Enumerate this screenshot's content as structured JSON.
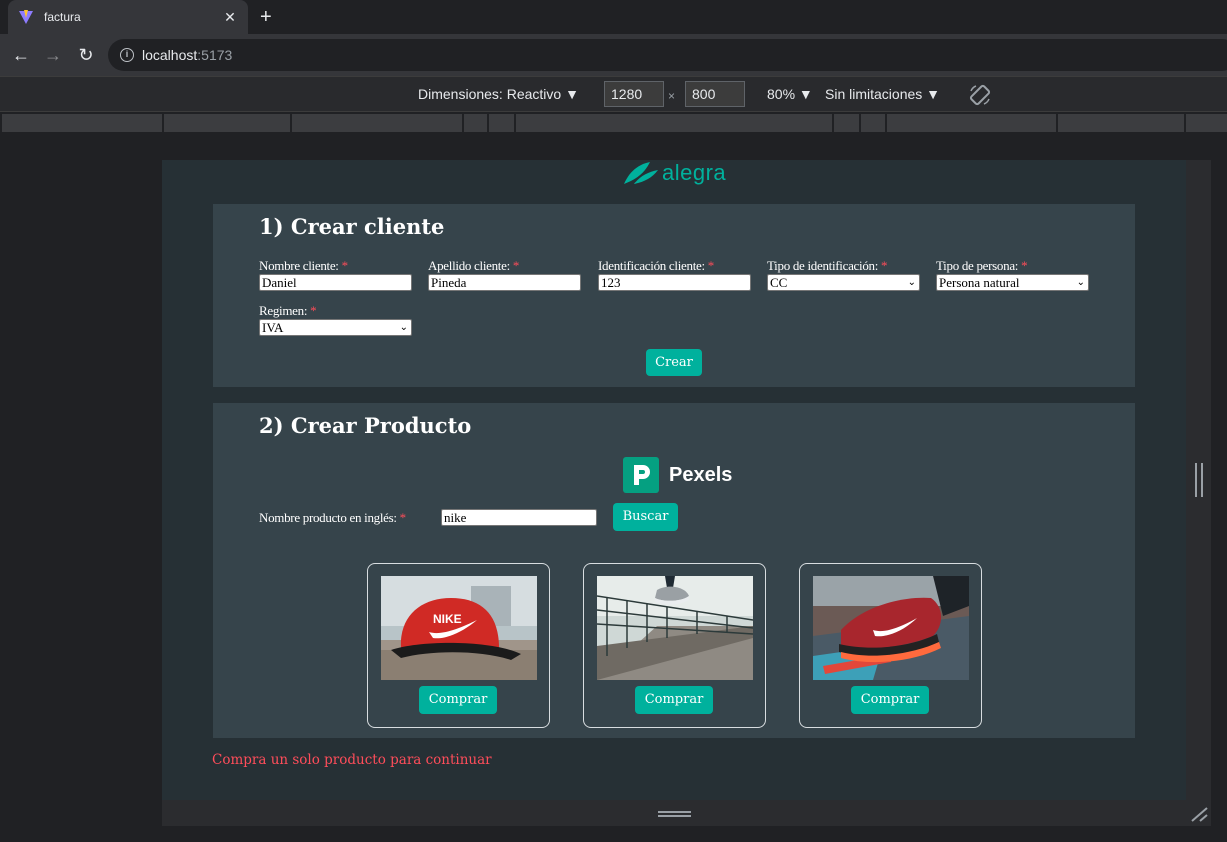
{
  "browser": {
    "tab_title": "factura",
    "url_host": "localhost",
    "url_port": ":5173"
  },
  "devtools": {
    "dimensions_label": "Dimensiones: Reactivo",
    "width": "1280",
    "height": "800",
    "times": "×",
    "zoom": "80%",
    "throttle": "Sin limitaciones"
  },
  "logo": {
    "text": "alegra"
  },
  "client_form": {
    "title": "1) Crear cliente",
    "fields": [
      {
        "label": "Nombre cliente:",
        "value": "Daniel",
        "type": "input"
      },
      {
        "label": "Apellido cliente:",
        "value": "Pineda",
        "type": "input"
      },
      {
        "label": "Identificación cliente:",
        "value": "123",
        "type": "input"
      },
      {
        "label": "Tipo de identificación:",
        "value": "CC",
        "type": "select"
      },
      {
        "label": "Tipo de persona:",
        "value": "Persona natural",
        "type": "select"
      },
      {
        "label": "Regimen:",
        "value": "IVA",
        "type": "select"
      }
    ],
    "required_mark": "*",
    "submit_label": "Crear"
  },
  "product_form": {
    "title": "2) Crear Producto",
    "provider_name": "Pexels",
    "search_label": "Nombre producto en inglés:",
    "required_mark": "*",
    "search_value": "nike",
    "search_button": "Buscar",
    "products": [
      {
        "image": "red nike cap",
        "buy_label": "Comprar"
      },
      {
        "image": "sneaker jumping on pier",
        "buy_label": "Comprar"
      },
      {
        "image": "red nike running shoe",
        "buy_label": "Comprar"
      }
    ]
  },
  "warning": "Compra un solo producto para continuar",
  "colors": {
    "accent": "#00b19d",
    "card": "#36444b",
    "page": "#263035",
    "error": "#ff4d5a"
  }
}
